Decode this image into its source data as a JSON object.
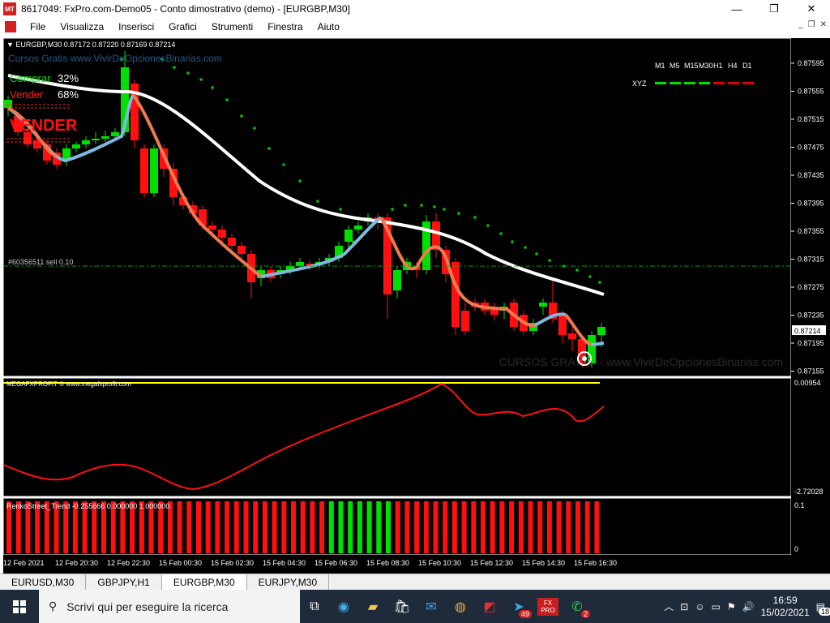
{
  "window": {
    "title": "8617049: FxPro.com-Demo05 - Conto dimostrativo (demo) - [EURGBP,M30]",
    "app_icon": "MT",
    "buttons": [
      "—",
      "❐",
      "✕"
    ]
  },
  "menu": {
    "items": [
      "File",
      "Visualizza",
      "Inserisci",
      "Grafici",
      "Strumenti",
      "Finestra",
      "Aiuto"
    ],
    "mdi": [
      "_",
      "❐",
      "✕"
    ]
  },
  "chart": {
    "symbol_header": "EURGBP,M30  0.87172 0.87220 0.87169 0.87214",
    "watermark_top": "Cursos Gratis   www.VivirDeOpcionesBinarias.com",
    "comprar_label": "Comprar",
    "comprar_value": "32%",
    "vender_label": "Vender",
    "vender_value": "68%",
    "vender_banner": "VENDER",
    "order_line_label": "#60356511 sell 0.10",
    "watermark_bottom": "CURSOS GRATIS -- www.VivirDeOpcionesBinarias.com",
    "timeframes": [
      "M1",
      "M5",
      "M15",
      "M30",
      "H1",
      "H4",
      "D1"
    ],
    "xyz_label": "XYZ",
    "xyz_colors": [
      "#00e000",
      "#00e000",
      "#00e000",
      "#00e000",
      "#e00000",
      "#e00000",
      "#e00000"
    ],
    "price_axis": [
      "0.87595",
      "0.87555",
      "0.87515",
      "0.87475",
      "0.87435",
      "0.87395",
      "0.87355",
      "0.87315",
      "0.87275",
      "0.87235",
      "0.87195",
      "0.87155"
    ],
    "current_price": "0.87214",
    "indicator1_label": "MEGAFXPROFIT © www.megafxprofit.com",
    "indicator1_axis": [
      "0.00954",
      "-2.72028"
    ],
    "indicator2_label": "RenkoStreet_Trend -0.255666 0.000000 1.000000",
    "indicator2_axis": [
      "0.1",
      "0"
    ],
    "time_axis": [
      "12 Feb 2021",
      "12 Feb 20:30",
      "12 Feb 22:30",
      "15 Feb 00:30",
      "15 Feb 02:30",
      "15 Feb 04:30",
      "15 Feb 06:30",
      "15 Feb 08:30",
      "15 Feb 10:30",
      "15 Feb 12:30",
      "15 Feb 14:30",
      "15 Feb 16:30"
    ],
    "colors": {
      "bull": "#00e000",
      "bear": "#ff1010",
      "ma": "#ffffff",
      "signal_up": "#7fb8e0",
      "signal_down": "#f07a50",
      "psar": "#00c800"
    }
  },
  "tabs": [
    "EURUSD,M30",
    "GBPJPY,H1",
    "EURGBP,M30",
    "EURJPY,M30"
  ],
  "active_tab": "EURGBP,M30",
  "taskbar": {
    "search_placeholder": "Scrivi qui per eseguire la ricerca",
    "badge_chrome_like": "49",
    "badge_whatsapp": "2",
    "fx_icon_text": "FX PRO",
    "clock_time": "16:59",
    "clock_date": "15/02/2021",
    "notif_count": "18"
  }
}
